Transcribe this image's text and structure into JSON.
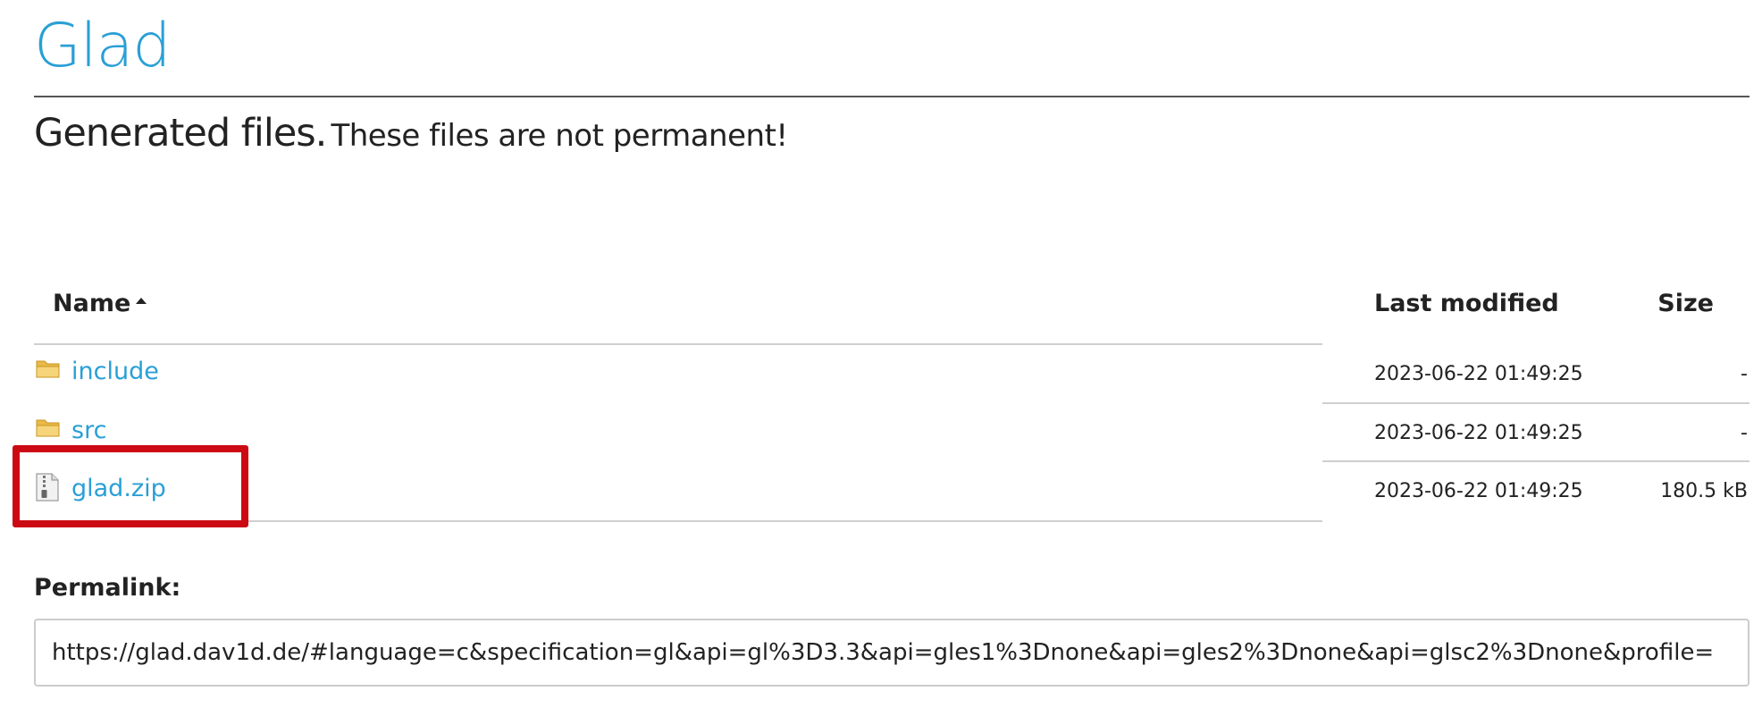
{
  "site": {
    "title": "Glad"
  },
  "heading": {
    "main": "Generated files.",
    "sub": "These files are not permanent!"
  },
  "table": {
    "columns": {
      "name": "Name",
      "last_modified": "Last modified",
      "size": "Size"
    },
    "sort_icon": "caret-up-icon",
    "rows": [
      {
        "icon": "folder-icon",
        "name": "include",
        "modified": "2023-06-22 01:49:25",
        "size": "-"
      },
      {
        "icon": "folder-icon",
        "name": "src",
        "modified": "2023-06-22 01:49:25",
        "size": "-"
      },
      {
        "icon": "zip-file-icon",
        "name": "glad.zip",
        "modified": "2023-06-22 01:49:25",
        "size": "180.5 kB"
      }
    ]
  },
  "permalink": {
    "label": "Permalink:",
    "value": "https://glad.dav1d.de/#language=c&specification=gl&api=gl%3D3.3&api=gles1%3Dnone&api=gles2%3Dnone&api=glsc2%3Dnone&profile="
  },
  "colors": {
    "link": "#2a9fd6",
    "highlight": "#cc0a14",
    "folder": "#f2c55c"
  }
}
